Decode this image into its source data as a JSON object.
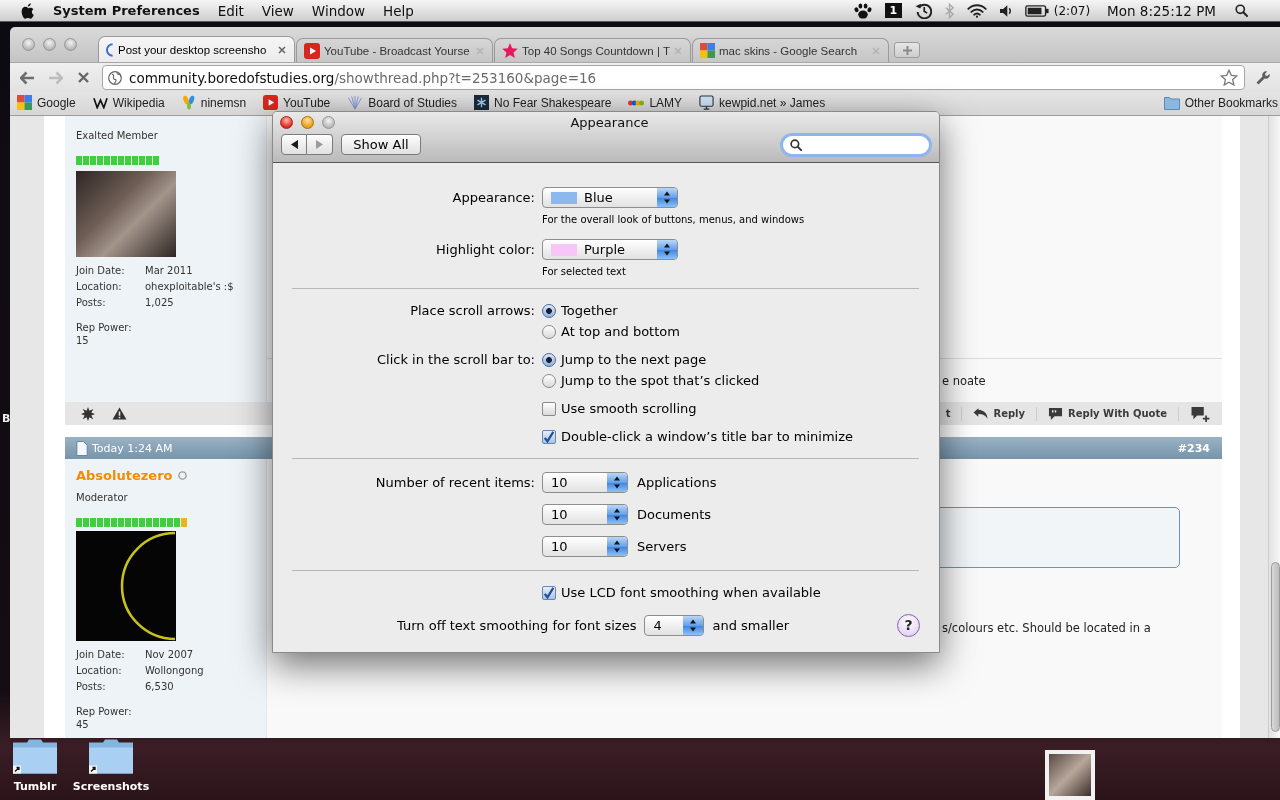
{
  "menu_bar": {
    "app_name": "System Preferences",
    "menus": [
      "Edit",
      "View",
      "Window",
      "Help"
    ],
    "number_tile": "1",
    "bluetooth_on": false,
    "battery_time": "(2:07)",
    "clock": "Mon 8:25:12 PM"
  },
  "desktop": {
    "partial_label": "B",
    "folders": [
      {
        "label": "Tumblr"
      },
      {
        "label": "Screenshots"
      }
    ]
  },
  "browser": {
    "active": false,
    "tabs": [
      {
        "title": "Post your desktop screensho",
        "selected": true
      },
      {
        "title": "YouTube - Broadcast Yourse",
        "selected": false
      },
      {
        "title": "Top 40 Songs Countdown | T",
        "selected": false
      },
      {
        "title": "mac skins - Google Search",
        "selected": false
      }
    ],
    "nav": [
      {
        "disabled": false
      },
      {
        "disabled": true
      }
    ],
    "address": {
      "host": "community.boredofstudies.org",
      "path": "/showthread.php?t=253160&page=16"
    },
    "bookmarks": [
      {
        "label": "Google"
      },
      {
        "label": "Wikipedia"
      },
      {
        "label": "ninemsn"
      },
      {
        "label": "YouTube"
      },
      {
        "label": "Board of Studies"
      },
      {
        "label": "No Fear Shakespeare"
      },
      {
        "label": "LAMY"
      },
      {
        "label": "kewpid.net » James"
      }
    ],
    "other_bookmarks": "Other Bookmarks"
  },
  "forum": {
    "posts": [
      {
        "user": {
          "rank": "Exalted Member",
          "rep_bar": [
            {
              "color": "#3fcf3f"
            },
            {
              "color": "#3fcf3f"
            },
            {
              "color": "#3fcf3f"
            },
            {
              "color": "#3fcf3f"
            },
            {
              "color": "#3fcf3f"
            },
            {
              "color": "#3fcf3f"
            },
            {
              "color": "#3fcf3f"
            },
            {
              "color": "#3fcf3f"
            },
            {
              "color": "#3fcf3f"
            },
            {
              "color": "#3fcf3f"
            },
            {
              "color": "#3fcf3f"
            },
            {
              "color": "#3fcf3f"
            }
          ],
          "details": [
            {
              "label": "Join Date:",
              "value": "Mar 2011"
            },
            {
              "label": "Location:",
              "value": "ohexploitable's :$"
            },
            {
              "label": "Posts:",
              "value": "1,025"
            }
          ],
          "rep_power_label": "Rep Power:",
          "rep_power": "15"
        },
        "body_fragment": "e noate",
        "footer_actions": [
          {
            "label": "t"
          },
          {
            "label": "Reply"
          },
          {
            "label": "Reply With Quote"
          }
        ]
      },
      {
        "header": {
          "date": "Today 1:24 AM",
          "number": "#234"
        },
        "user": {
          "name": "Absolutezero",
          "online": false,
          "rank": "Moderator",
          "rep_bar": [
            {
              "color": "#3fcf3f"
            },
            {
              "color": "#3fcf3f"
            },
            {
              "color": "#3fcf3f"
            },
            {
              "color": "#3fcf3f"
            },
            {
              "color": "#3fcf3f"
            },
            {
              "color": "#3fcf3f"
            },
            {
              "color": "#3fcf3f"
            },
            {
              "color": "#3fcf3f"
            },
            {
              "color": "#3fcf3f"
            },
            {
              "color": "#3fcf3f"
            },
            {
              "color": "#3fcf3f"
            },
            {
              "color": "#3fcf3f"
            },
            {
              "color": "#3fcf3f"
            },
            {
              "color": "#3fcf3f"
            },
            {
              "color": "#3fcf3f"
            },
            {
              "color": "#e8b51c"
            }
          ],
          "details": [
            {
              "label": "Join Date:",
              "value": "Nov 2007"
            },
            {
              "label": "Location:",
              "value": "Wollongong"
            },
            {
              "label": "Posts:",
              "value": "6,530"
            }
          ],
          "rep_power_label": "Rep Power:",
          "rep_power": "45"
        },
        "body_fragment": "s/colours etc. Should be located in a"
      }
    ]
  },
  "dialog": {
    "active": true,
    "resizable": false,
    "title": "Appearance",
    "nav": [
      {
        "disabled": false
      },
      {
        "disabled": true
      }
    ],
    "show_all": "Show All",
    "sections": [
      {
        "rows": [
          {
            "kind": "popup",
            "label": "Appearance:",
            "value": "Blue",
            "color": "#8db8ee",
            "hint": "For the overall look of buttons, menus, and windows"
          },
          {
            "kind": "popup",
            "label": "Highlight color:",
            "value": "Purple",
            "color": "#f6c6f6",
            "hint": "For selected text"
          }
        ]
      },
      {
        "rows": [
          {
            "kind": "radios",
            "label": "Place scroll arrows:",
            "options": [
              {
                "label": "Together",
                "selected": true
              },
              {
                "label": "At top and bottom",
                "selected": false
              }
            ]
          },
          {
            "kind": "radios",
            "label": "Click in the scroll bar to:",
            "options": [
              {
                "label": "Jump to the next page",
                "selected": true
              },
              {
                "label": "Jump to the spot that’s clicked",
                "selected": false
              }
            ]
          },
          {
            "kind": "checkbox",
            "label": "Use smooth scrolling",
            "checked": false
          },
          {
            "kind": "checkbox",
            "label": "Double-click a window’s title bar to minimize",
            "checked": true
          }
        ]
      },
      {
        "rows": [
          {
            "kind": "count",
            "label": "Number of recent items:",
            "value": "10",
            "suffix": "Applications"
          },
          {
            "kind": "count",
            "value": "10",
            "suffix": "Documents"
          },
          {
            "kind": "count",
            "value": "10",
            "suffix": "Servers"
          }
        ]
      },
      {
        "rows": [
          {
            "kind": "checkbox",
            "label": "Use LCD font smoothing when available",
            "checked": true
          },
          {
            "kind": "inline",
            "label": "Turn off text smoothing for font sizes",
            "value": "4",
            "suffix": "and smaller"
          }
        ]
      }
    ],
    "help": "?"
  }
}
